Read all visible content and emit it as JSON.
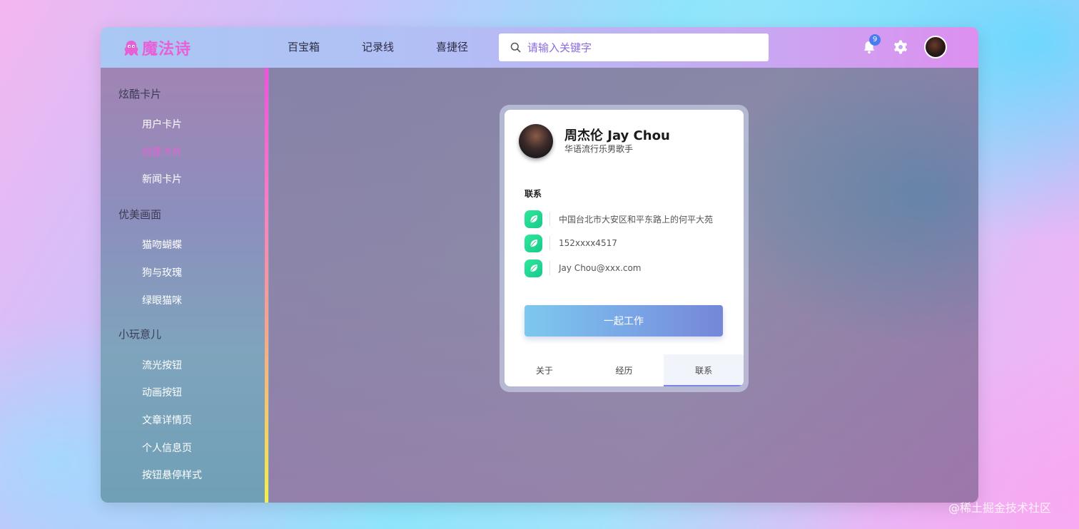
{
  "logo": {
    "text": "魔法诗",
    "icon": "octopus-icon",
    "color": "#e860d8"
  },
  "nav": [
    "百宝箱",
    "记录线",
    "喜捷径"
  ],
  "search": {
    "placeholder": "请输入关键字",
    "value": ""
  },
  "notifications": {
    "count": "9",
    "icon": "bell-icon"
  },
  "settings": {
    "icon": "gear-icon"
  },
  "sidebar": {
    "groups": [
      {
        "title": "炫酷卡片",
        "items": [
          "用户卡片",
          "创意卡片",
          "新闻卡片"
        ]
      },
      {
        "title": "优美画面",
        "items": [
          "猫吻蝴蝶",
          "狗与玫瑰",
          "绿眼猫咪"
        ]
      },
      {
        "title": "小玩意儿",
        "items": [
          "流光按钮",
          "动画按钮",
          "文章详情页",
          "个人信息页",
          "按钮悬停样式"
        ]
      }
    ],
    "active_item": "创意卡片"
  },
  "card": {
    "name": "周杰伦 Jay Chou",
    "subtitle": "华语流行乐男歌手",
    "section_title": "联系",
    "contacts": [
      {
        "icon": "leaf-icon",
        "text": "中国台北市大安区和平东路上的何平大苑"
      },
      {
        "icon": "leaf-icon",
        "text": "152xxxx4517"
      },
      {
        "icon": "leaf-icon",
        "text": "Jay Chou@xxx.com"
      }
    ],
    "button": "一起工作",
    "tabs": [
      "关于",
      "经历",
      "联系"
    ],
    "active_tab": "联系"
  },
  "watermark": "@稀土掘金技术社区",
  "colors": {
    "accent": "#e860d8",
    "badge": "#4b7bf0",
    "leaf": "#1fd392",
    "tab_indicator": "#7a86e3"
  }
}
